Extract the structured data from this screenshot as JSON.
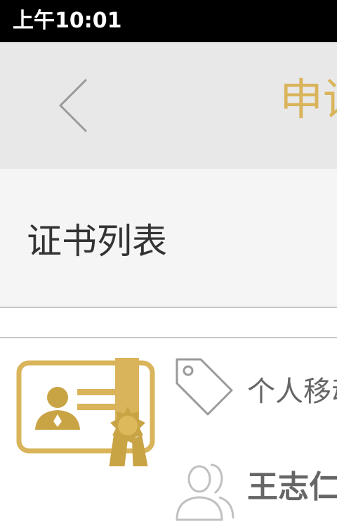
{
  "status_bar": {
    "time": "上午10:01"
  },
  "nav": {
    "title": "申请",
    "back_icon": "chevron-left-icon"
  },
  "section": {
    "title": "证书列表"
  },
  "certificates": [
    {
      "icon": "certificate-icon",
      "type_icon": "tag-icon",
      "type": "个人移动证书",
      "holder_icon": "users-icon",
      "holder": "王志仁"
    }
  ],
  "colors": {
    "accent_gold": "#d9b45a",
    "nav_background": "#e8e8e8",
    "status_background": "#000000",
    "divider": "#c8c8c8"
  }
}
